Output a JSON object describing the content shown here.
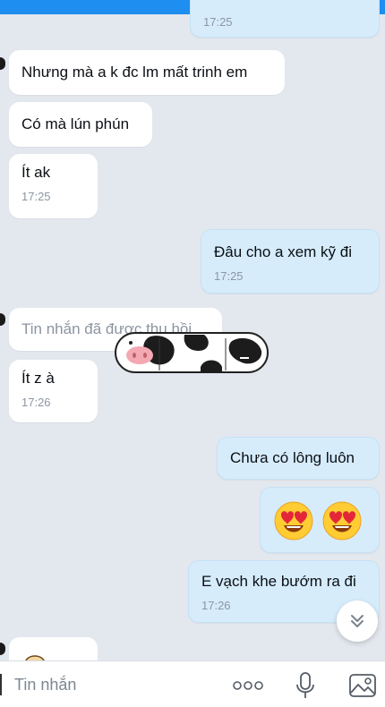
{
  "messages": [
    {
      "id": "m0",
      "side": "out",
      "time": "17:25"
    },
    {
      "id": "m1",
      "side": "in",
      "text": "Nhưng mà a k đc lm mất trinh em"
    },
    {
      "id": "m2",
      "side": "in",
      "text": "Có mà lún phún"
    },
    {
      "id": "m3",
      "side": "in",
      "text": "Ít ak",
      "time": "17:25"
    },
    {
      "id": "m4",
      "side": "out",
      "text": "Đâu cho a xem kỹ đi",
      "time": "17:25"
    },
    {
      "id": "m5",
      "side": "in",
      "text": "Tin nhắn đã được thu hồi",
      "recalled": true
    },
    {
      "id": "m6",
      "side": "in",
      "text": "Ít z à",
      "time": "17:26"
    },
    {
      "id": "m7",
      "side": "out",
      "text": "Chưa có lông luôn"
    },
    {
      "id": "m8",
      "side": "out",
      "emoji": [
        "heart-eyes",
        "heart-eyes"
      ]
    },
    {
      "id": "m9",
      "side": "out",
      "text": "E vạch khe bướm ra đi",
      "time": "17:26"
    }
  ],
  "input": {
    "placeholder": "Tin nhắn"
  },
  "icons": {
    "more": "more-dots-icon",
    "mic": "microphone-icon",
    "image": "image-icon",
    "scroll": "chevron-double-down-icon"
  },
  "colors": {
    "background": "#e3e8ee",
    "incoming": "#ffffff",
    "outgoing": "#d6ecfb",
    "accent": "#1e8ef0"
  }
}
